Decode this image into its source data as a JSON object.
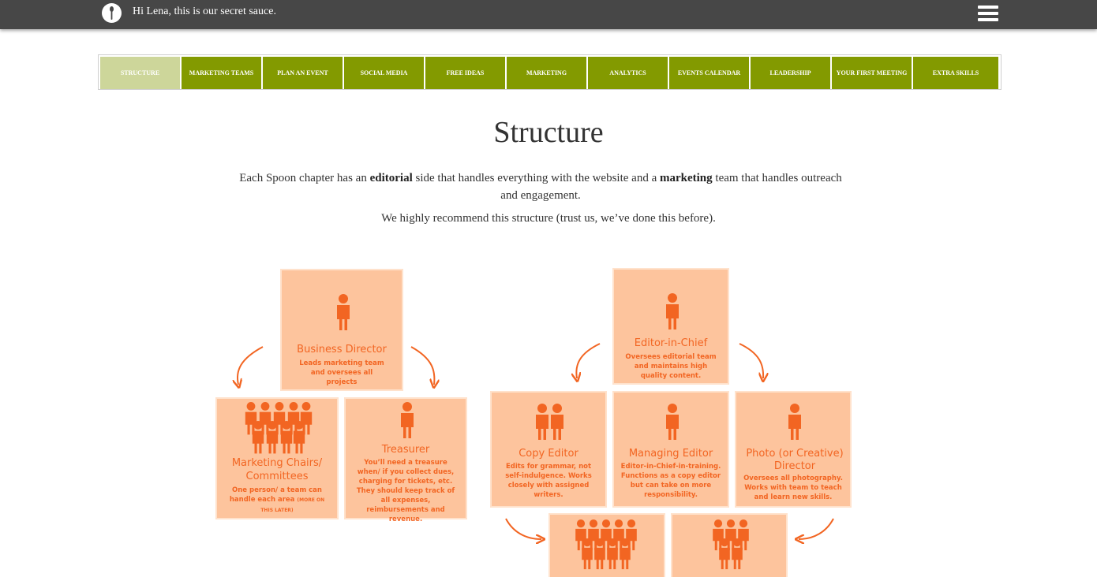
{
  "header": {
    "greeting": "Hi Lena, this is our secret sauce.",
    "logo_icon": "spoon-logo-icon",
    "menu_icon": "hamburger-menu-icon"
  },
  "nav": {
    "tabs": [
      {
        "label": "Structure",
        "active": true
      },
      {
        "label": "Marketing Teams",
        "active": false
      },
      {
        "label": "Plan an Event",
        "active": false
      },
      {
        "label": "Social Media",
        "active": false
      },
      {
        "label": "Free Ideas",
        "active": false
      },
      {
        "label": "Marketing",
        "active": false
      },
      {
        "label": "Analytics",
        "active": false
      },
      {
        "label": "Events Calendar",
        "active": false
      },
      {
        "label": "Leadership",
        "active": false
      },
      {
        "label": "Your First Meeting",
        "active": false
      },
      {
        "label": "Extra Skills",
        "active": false
      }
    ]
  },
  "page": {
    "title": "Structure",
    "intro_a": "Each Spoon chapter has an ",
    "intro_b": "editorial",
    "intro_c": " side that handles everything with the website and a ",
    "intro_d": "marketing",
    "intro_e": " team that handles outreach and engagement.",
    "intro2": "We highly recommend this structure (trust us, we’ve done this before)."
  },
  "marketing": {
    "director": {
      "role": "Business Director",
      "desc": "Leads marketing team and oversees all projects"
    },
    "chairs": {
      "role_1": "Marketing Chairs/",
      "role_2": "Committees",
      "desc": "One person/ a team can handle each area",
      "desc_small": "(MORE ON THIS LATER)"
    },
    "treasurer": {
      "role": "Treasurer",
      "desc": "You’ll need a treasure when/ if you collect dues, charging for tickets, etc. They should keep track of all expenses, reimbursements and revenue."
    }
  },
  "editorial": {
    "chief": {
      "role": "Editor-in-Chief",
      "desc": "Oversees editorial team and maintains high quality content."
    },
    "copy": {
      "role": "Copy Editor",
      "desc": "Edits for grammar, not self-indulgence. Works closely with assigned writers."
    },
    "managing": {
      "role": "Managing Editor",
      "desc": "Editor-in-Chief-in-training. Functions as a copy editor but can take on more responsibility."
    },
    "photo": {
      "role": "Photo (or Creative) Director",
      "desc": "Oversees all photography. Works with team to teach and learn new skills."
    }
  },
  "colors": {
    "topbar": "#474747",
    "tab": "#839a00",
    "tab_active": "#cdd69a",
    "box": "#fdc49d",
    "accent": "#f26522"
  }
}
